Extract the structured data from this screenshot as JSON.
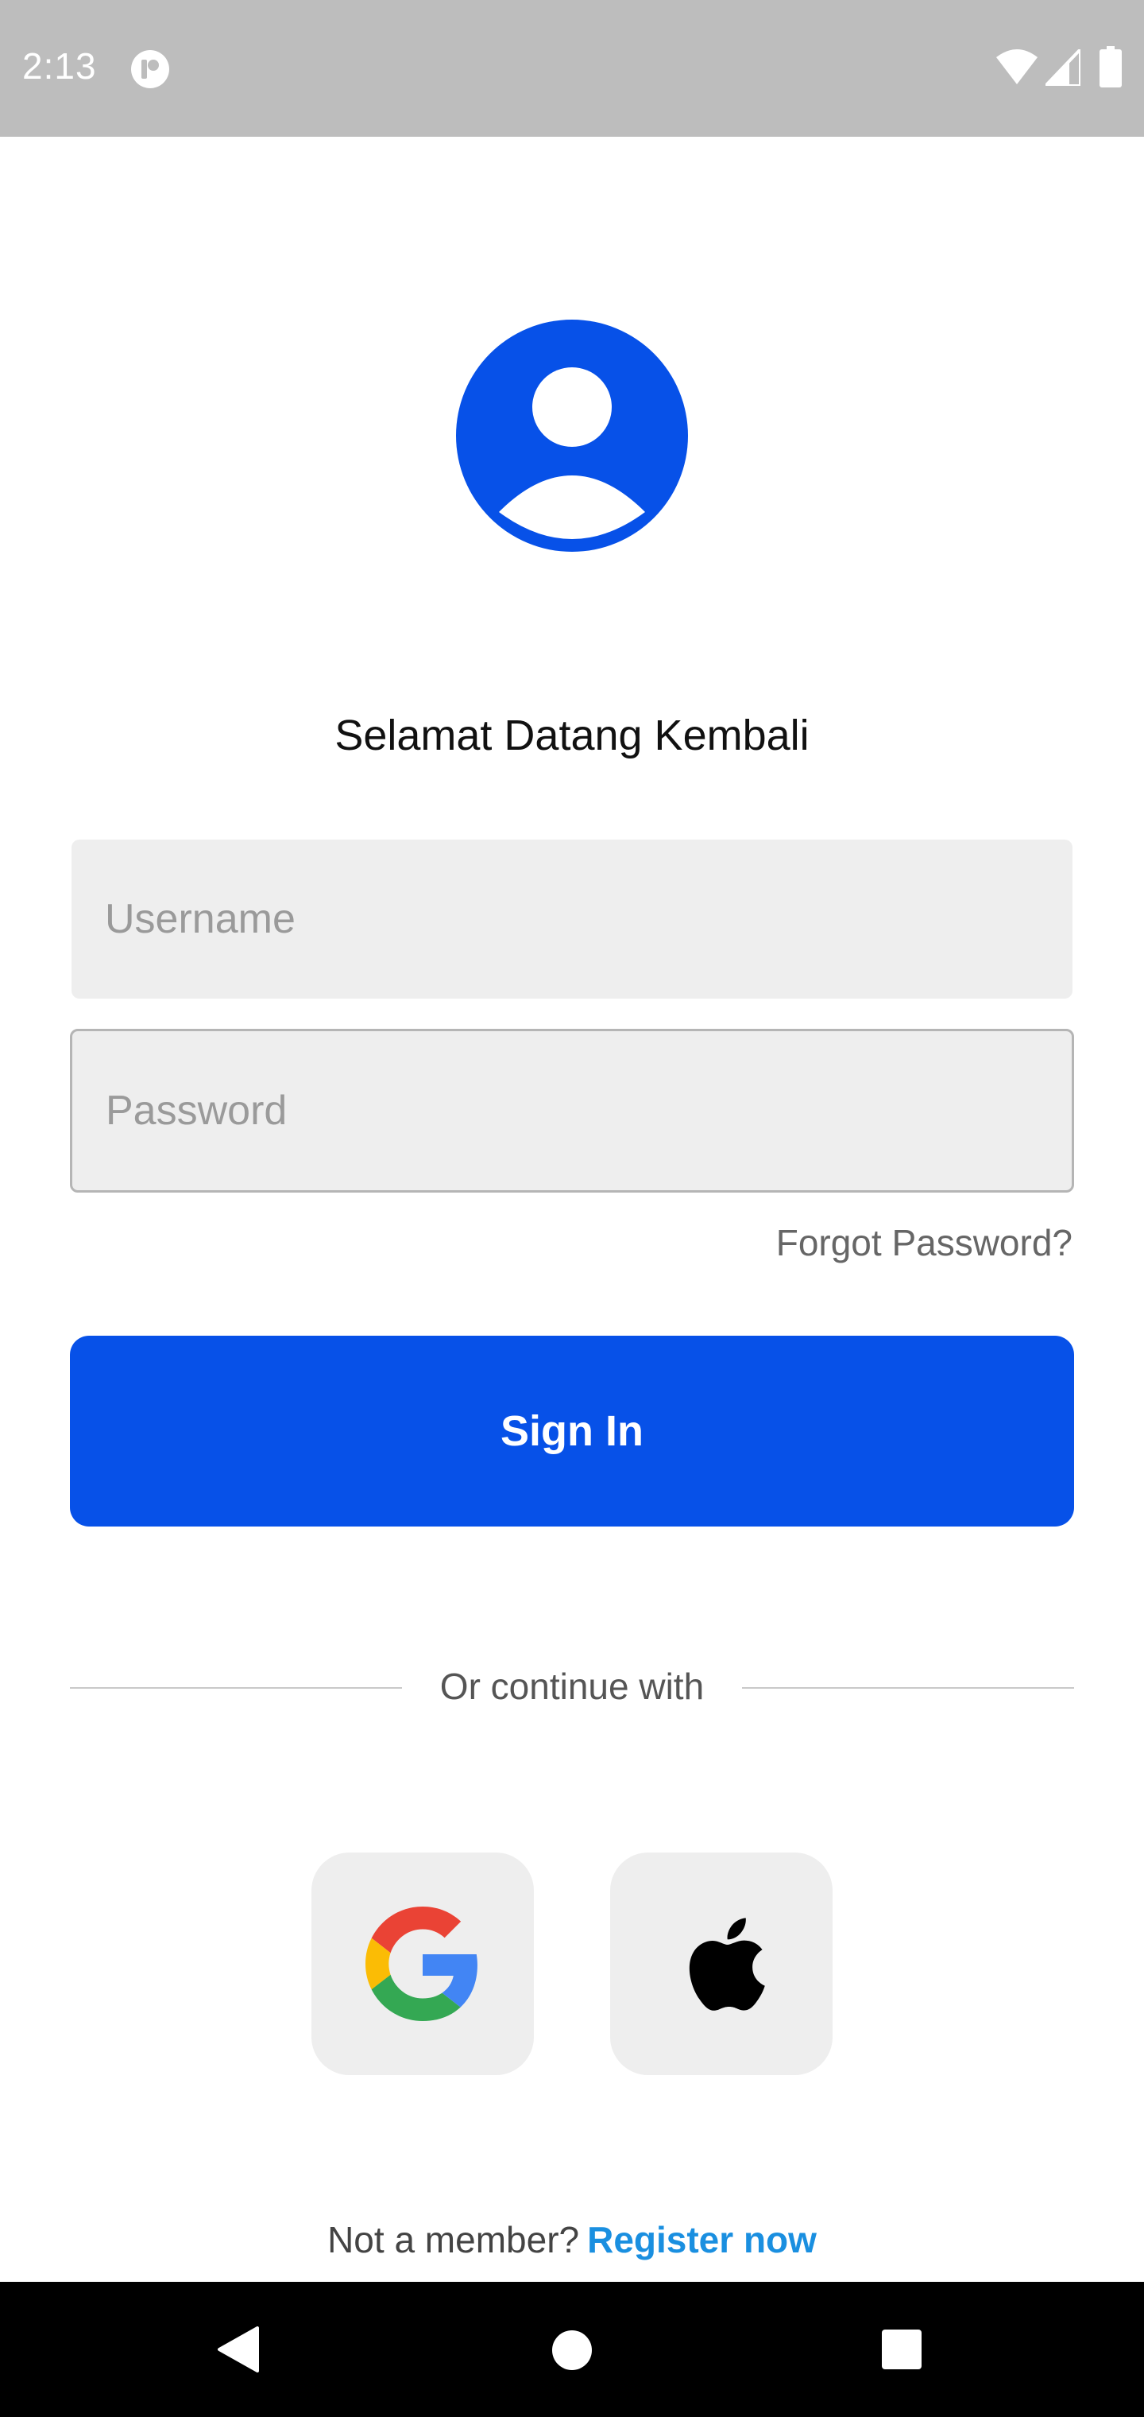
{
  "status_bar": {
    "time": "2:13"
  },
  "login": {
    "welcome_text": "Selamat Datang Kembali",
    "username_placeholder": "Username",
    "password_placeholder": "Password",
    "forgot_password_label": "Forgot Password?",
    "sign_in_label": "Sign In",
    "divider_text": "Or continue with",
    "register_prompt": "Not a member?",
    "register_link": "Register now"
  },
  "colors": {
    "primary": "#0751e8",
    "link": "#1a8fe0",
    "input_bg": "#eeeeee",
    "status_bar": "#bdbdbd"
  },
  "icons": {
    "avatar": "account-circle-icon",
    "google": "google-icon",
    "apple": "apple-icon"
  }
}
